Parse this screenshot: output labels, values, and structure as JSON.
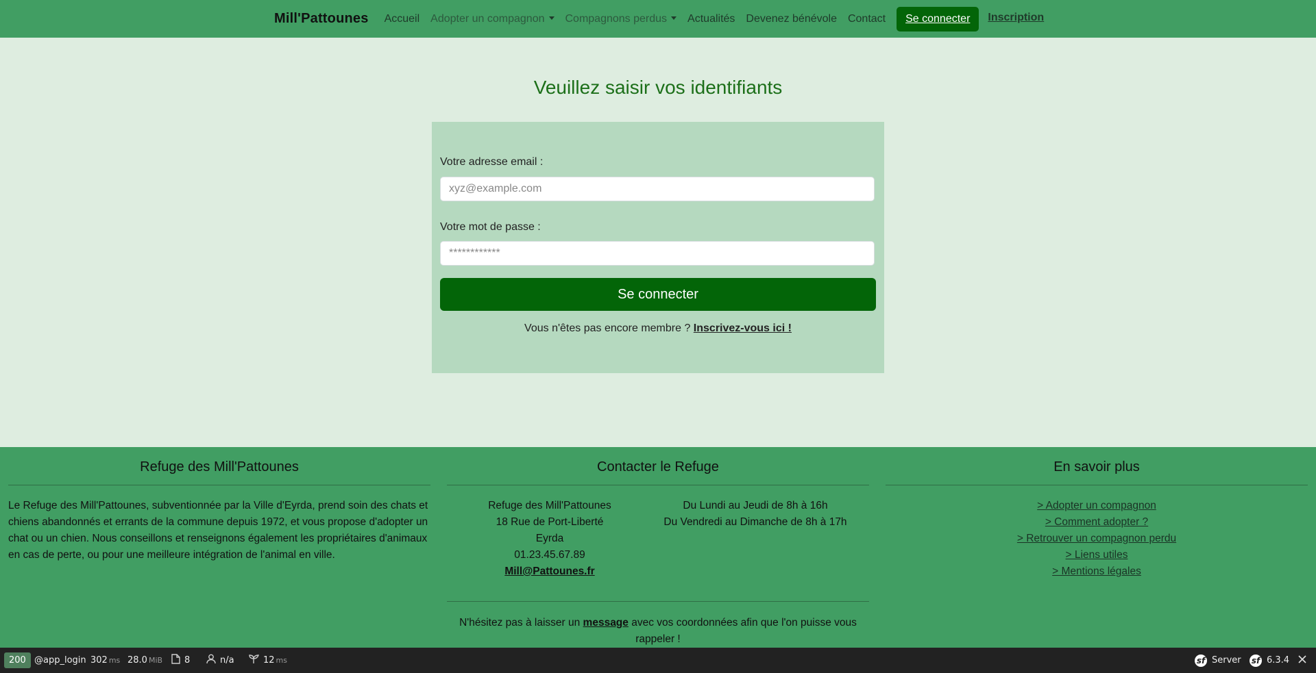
{
  "navbar": {
    "brand": "Mill'Pattounes",
    "links": [
      {
        "label": "Accueil"
      },
      {
        "label": "Adopter un compagnon"
      },
      {
        "label": "Compagnons perdus"
      },
      {
        "label": "Actualités"
      },
      {
        "label": "Devenez bénévole"
      },
      {
        "label": "Contact"
      }
    ],
    "login_button": "Se connecter",
    "register_link": "Inscription"
  },
  "login": {
    "title": "Veuillez saisir vos identifiants",
    "email_label": "Votre adresse email :",
    "email_placeholder": "xyz@example.com",
    "password_label": "Votre mot de passe :",
    "password_placeholder": "************",
    "submit_label": "Se connecter",
    "signup_prompt": "Vous n'êtes pas encore membre ?",
    "signup_link": "Inscrivez-vous ici !"
  },
  "footer": {
    "about": {
      "title": "Refuge des Mill'Pattounes",
      "text": "Le Refuge des Mill'Pattounes, subventionnée par la Ville d'Eyrda, prend soin des chats et chiens abandonnés et errants de la commune depuis 1972, et vous propose d'adopter un chat ou un chien. Nous conseillons et renseignons également les propriétaires d'animaux en cas de perte, ou pour une meilleure intégration de l'animal en ville."
    },
    "contact": {
      "title": "Contacter le Refuge",
      "name": "Refuge des Mill'Pattounes",
      "street": "18 Rue de Port-Liberté",
      "city": "Eyrda",
      "phone": "01.23.45.67.89",
      "email": "Mill@Pattounes.fr",
      "hours_weekday": "Du Lundi au Jeudi de 8h à 16h",
      "hours_weekend": "Du Vendredi au Dimanche de 8h à 17h",
      "message_before": "N'hésitez pas à laisser un",
      "message_link": "message",
      "message_after": "avec vos coordonnées afin que l'on puisse vous rappeler !"
    },
    "more": {
      "title": "En savoir plus",
      "links": [
        "> Adopter un compagnon",
        "> Comment adopter ?",
        "> Retrouver un compagnon perdu",
        "> Liens utiles",
        "> Mentions légales"
      ]
    }
  },
  "debug_toolbar": {
    "status": "200",
    "route": "@app_login",
    "time_value": "302",
    "time_unit": "ms",
    "memory_value": "28.0",
    "memory_unit": "MiB",
    "forms_count": "8",
    "user": "n/a",
    "init_value": "12",
    "init_unit": "ms",
    "server_label": "Server",
    "symfony_version": "6.3.4"
  },
  "colors": {
    "nav_bg": "#419e63",
    "page_bg": "#deede0",
    "card_bg": "#b5d9bf",
    "primary_button": "#036508",
    "title_green": "#1c6f19"
  }
}
